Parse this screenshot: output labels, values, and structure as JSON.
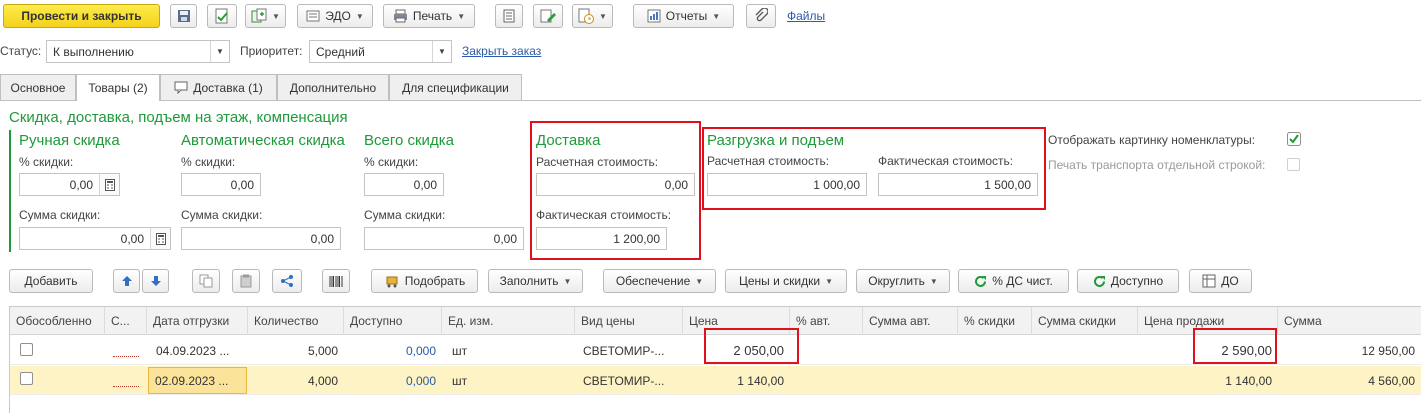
{
  "toolbar": {
    "post_close_label": "Провести и закрыть",
    "edo_label": "ЭДО",
    "print_label": "Печать",
    "reports_label": "Отчеты",
    "files_label": "Файлы"
  },
  "header": {
    "status_label": "Статус:",
    "status_value": "К выполнению",
    "priority_label": "Приоритет:",
    "priority_value": "Средний",
    "close_order_link": "Закрыть заказ"
  },
  "tabs": [
    {
      "label": "Основное"
    },
    {
      "label": "Товары (2)"
    },
    {
      "label": "Доставка (1)"
    },
    {
      "label": "Дополнительно"
    },
    {
      "label": "Для спецификации"
    }
  ],
  "section": {
    "title": "Скидка, доставка, подъем на этаж, компенсация",
    "manual": {
      "title": "Ручная скидка",
      "percent_label": "% скидки:",
      "percent_value": "0,00",
      "sum_label": "Сумма скидки:",
      "sum_value": "0,00"
    },
    "auto": {
      "title": "Автоматическая скидка",
      "percent_label": "%  скидки:",
      "percent_value": "0,00",
      "sum_label": "Сумма скидки:",
      "sum_value": "0,00"
    },
    "total": {
      "title": "Всего скидка",
      "percent_label": "%  скидки:",
      "percent_value": "0,00",
      "sum_label": "Сумма скидки:",
      "sum_value": "0,00"
    },
    "delivery": {
      "title": "Доставка",
      "estimated_label": "Расчетная стоимость:",
      "estimated_value": "0,00",
      "actual_label": "Фактическая стоимость:",
      "actual_value": "1 200,00"
    },
    "unloading": {
      "title": "Разгрузка и подъем",
      "estimated_label": "Расчетная стоимость:",
      "estimated_value": "1 000,00",
      "actual_label": "Фактическая стоимость:",
      "actual_value": "1 500,00"
    },
    "show_picture_label": "Отображать картинку номенклатуры:",
    "show_picture_checked": true,
    "print_transport_label": "Печать транспорта отдельной строкой:",
    "print_transport_checked": false
  },
  "grid_toolbar": {
    "add_label": "Добавить",
    "pick_label": "Подобрать",
    "fill_label": "Заполнить",
    "supply_label": "Обеспечение",
    "prices_label": "Цены и скидки",
    "round_label": "Округлить",
    "ds_label": "% ДС чист.",
    "available_label": "Доступно",
    "do_label": "ДО"
  },
  "table": {
    "columns": [
      "Обособленно",
      "С...",
      "Дата отгрузки",
      "Количество",
      "Доступно",
      "Ед. изм.",
      "Вид цены",
      "Цена",
      "% авт.",
      "Сумма авт.",
      "% скидки",
      "Сумма скидки",
      "Цена продажи",
      "Сумма"
    ],
    "rows": [
      {
        "date": "04.09.2023 ...",
        "qty": "5,000",
        "available": "0,000",
        "unit": "шт",
        "price_type": "СВЕТОМИР-...",
        "price": "2 050,00",
        "sale_price": "2 590,00",
        "sum": "12 950,00"
      },
      {
        "date": "02.09.2023 ...",
        "qty": "4,000",
        "available": "0,000",
        "unit": "шт",
        "price_type": "СВЕТОМИР-...",
        "price": "1 140,00",
        "sale_price": "1 140,00",
        "sum": "4 560,00"
      }
    ]
  },
  "colors": {
    "accent_green": "#1e9a3a",
    "highlight_red": "#e0101c",
    "selected_row": "#fdf3c4",
    "primary_button": "#f4d21c"
  }
}
